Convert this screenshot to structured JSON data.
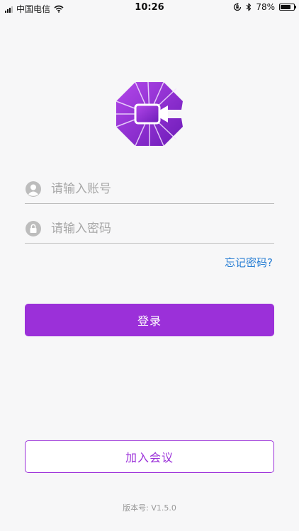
{
  "status_bar": {
    "carrier": "中国电信",
    "time": "10:26",
    "battery_percent_label": "78%",
    "battery_level": 0.78
  },
  "login": {
    "account_placeholder": "请输入账号",
    "account_value": "",
    "password_placeholder": "请输入密码",
    "password_value": "",
    "forgot_label": "忘记密码?",
    "login_label": "登录",
    "join_label": "加入会议"
  },
  "footer": {
    "version_label": "版本号: V1.5.0"
  },
  "colors": {
    "brand_purple": "#9b30d9",
    "link_blue": "#2a7fd4"
  },
  "icons": {
    "signal": "cellular-signal-icon",
    "wifi": "wifi-icon",
    "lock_rotation": "rotation-lock-icon",
    "bluetooth": "bluetooth-icon",
    "battery": "battery-icon",
    "app_logo": "video-camera-logo",
    "user": "user-icon",
    "lock": "lock-icon"
  }
}
